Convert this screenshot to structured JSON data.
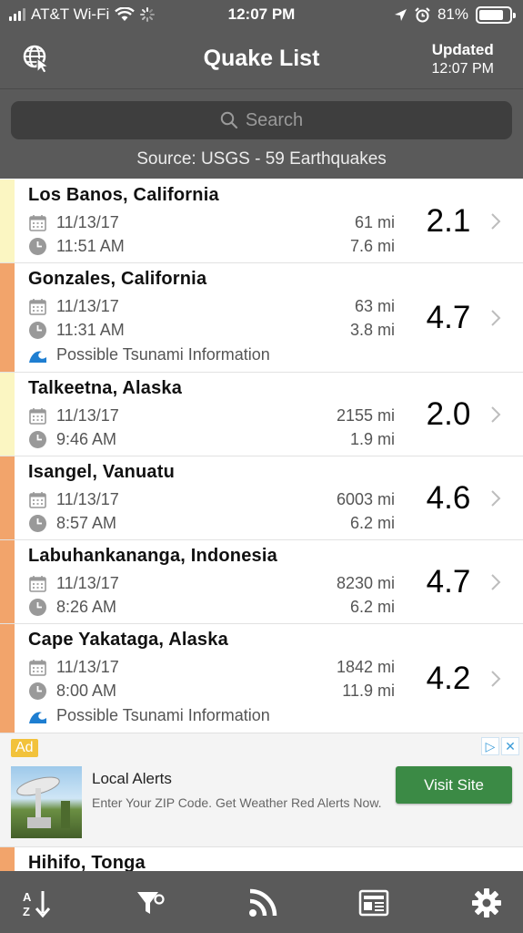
{
  "status_bar": {
    "carrier": "AT&T Wi-Fi",
    "time": "12:07 PM",
    "battery": "81%",
    "battery_level": 0.81
  },
  "nav": {
    "title": "Quake List",
    "updated_label": "Updated",
    "updated_time": "12:07 PM",
    "globe_icon": "globe-cursor-icon"
  },
  "search": {
    "placeholder": "Search"
  },
  "source_text": "Source: USGS - 59 Earthquakes",
  "colors": {
    "header_bg": "#5a5a5a",
    "low_mag": "#fbf6c2",
    "high_mag": "#f2a46b",
    "tsunami": "#1e7ed1",
    "ad_button": "#3b8a45"
  },
  "quakes": [
    {
      "place": "Los Banos, California",
      "date": "11/13/17",
      "time": "11:51 AM",
      "distance": "61 mi",
      "depth": "7.6 mi",
      "magnitude": "2.1",
      "tsunami": ""
    },
    {
      "place": "Gonzales, California",
      "date": "11/13/17",
      "time": "11:31 AM",
      "distance": "63 mi",
      "depth": "3.8 mi",
      "magnitude": "4.7",
      "tsunami": "Possible Tsunami Information"
    },
    {
      "place": "Talkeetna, Alaska",
      "date": "11/13/17",
      "time": "9:46 AM",
      "distance": "2155 mi",
      "depth": "1.9 mi",
      "magnitude": "2.0",
      "tsunami": ""
    },
    {
      "place": "Isangel, Vanuatu",
      "date": "11/13/17",
      "time": "8:57 AM",
      "distance": "6003 mi",
      "depth": "6.2 mi",
      "magnitude": "4.6",
      "tsunami": ""
    },
    {
      "place": "Labuhankananga, Indonesia",
      "date": "11/13/17",
      "time": "8:26 AM",
      "distance": "8230 mi",
      "depth": "6.2 mi",
      "magnitude": "4.7",
      "tsunami": ""
    },
    {
      "place": "Cape Yakataga, Alaska",
      "date": "11/13/17",
      "time": "8:00 AM",
      "distance": "1842 mi",
      "depth": "11.9 mi",
      "magnitude": "4.2",
      "tsunami": "Possible Tsunami Information"
    }
  ],
  "ad": {
    "tag": "Ad",
    "title": "Local Alerts",
    "text": "Enter Your ZIP Code. Get Weather Red Alerts Now.",
    "button": "Visit Site"
  },
  "partial_quake": {
    "place": "Hihifo, Tonga"
  },
  "tab_bar": {
    "items": [
      "sort-az-icon",
      "filter-icon",
      "rss-feed-icon",
      "news-icon",
      "settings-gear-icon"
    ]
  }
}
